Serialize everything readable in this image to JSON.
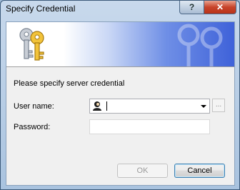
{
  "window": {
    "title": "Specify Credential",
    "help_label": "?",
    "close_label": "✕"
  },
  "banner": {
    "icon": "keys-icon",
    "watermark": "keys-watermark-icon"
  },
  "form": {
    "prompt": "Please specify server credential",
    "user_label": "User name:",
    "user_value": "",
    "password_label": "Password:",
    "password_value": "",
    "browse_label": "..."
  },
  "buttons": {
    "ok": "OK",
    "cancel": "Cancel"
  },
  "colors": {
    "banner_blue": "#3f62d9",
    "close_red": "#c7432a",
    "frame": "#a9c3df"
  }
}
